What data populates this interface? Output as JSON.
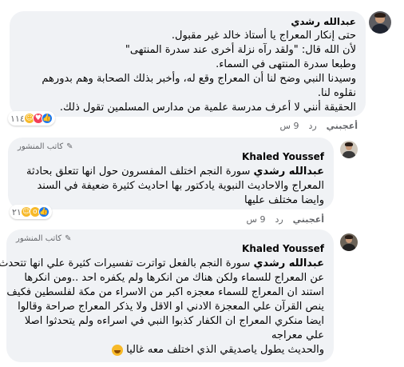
{
  "comments": [
    {
      "author": "عبدالله رشدي",
      "lines": [
        "حتى إنكار المعراج يا أستاذ خالد غير مقبول.",
        "لأن الله قال: \"ولقد رآه نزلة أخرى عند سدرة المنتهى\"",
        "وطبعا سدرة المنتهى في السماء.",
        "وسيدنا النبي وضح لنا أن المعراج وقع له، وأخبر بذلك الصحابة وهم بدورهم",
        "نقلوه لنا.",
        "الحقيقة أنني لا أعرف مدرسة علمية من مدارس المسلمين تقول ذلك."
      ],
      "reactions": {
        "count": "١١٤",
        "icons": [
          "like-icon",
          "love-icon",
          "haha-icon"
        ]
      },
      "meta": {
        "like_label": "أعجبني",
        "reply_label": "رد",
        "time": "9 س"
      }
    },
    {
      "badge": "كاتب المنشور",
      "author": "Khaled Youssef",
      "mention": "عبدالله رشدي",
      "first_line_rest": " سورة النجم اختلف المفسرون حول انها تتعلق بحادثة",
      "lines": [
        "المعراج والاحاديث النبوية يادكتور بها احاديث كثيرة ضعيفة في السند",
        "وايضا مختلف عليها"
      ],
      "reactions": {
        "count": "٢١",
        "icons": [
          "like-icon",
          "wow-icon",
          "haha-icon"
        ]
      },
      "meta": {
        "like_label": "أعجبني",
        "reply_label": "رد",
        "time": "9 س"
      }
    },
    {
      "badge": "كاتب المنشور",
      "author": "Khaled Youssef",
      "mention": "عبدالله رشدي",
      "first_line_rest": " سورة النجم بالفعل تواترت تفسيرات كثيرة علي انها تتحدث",
      "lines": [
        "عن المعراج للسماء ولكن هناك من انكرها ولم يكفره احد ..ومن انكرها",
        "استند ان المعراج للسماء معجزه اكبر من الاسراء من مكة لفلسطين فكيف",
        "ينص القرآن علي المعجزة الادني او الاقل ولا يذكر المعراج صراحة وقالوا",
        "ايضا منكري المعراج ان الكفار كذبوا النبي في اسراءه ولم يتحدثوا اصلا",
        "علي معراجه",
        "والحديث يطول ياصديقي الذي اختلف معه غاليا"
      ],
      "meta": {
        "like_label": "أعجبني",
        "reply_label": "رد",
        "time": "9 س"
      }
    }
  ]
}
